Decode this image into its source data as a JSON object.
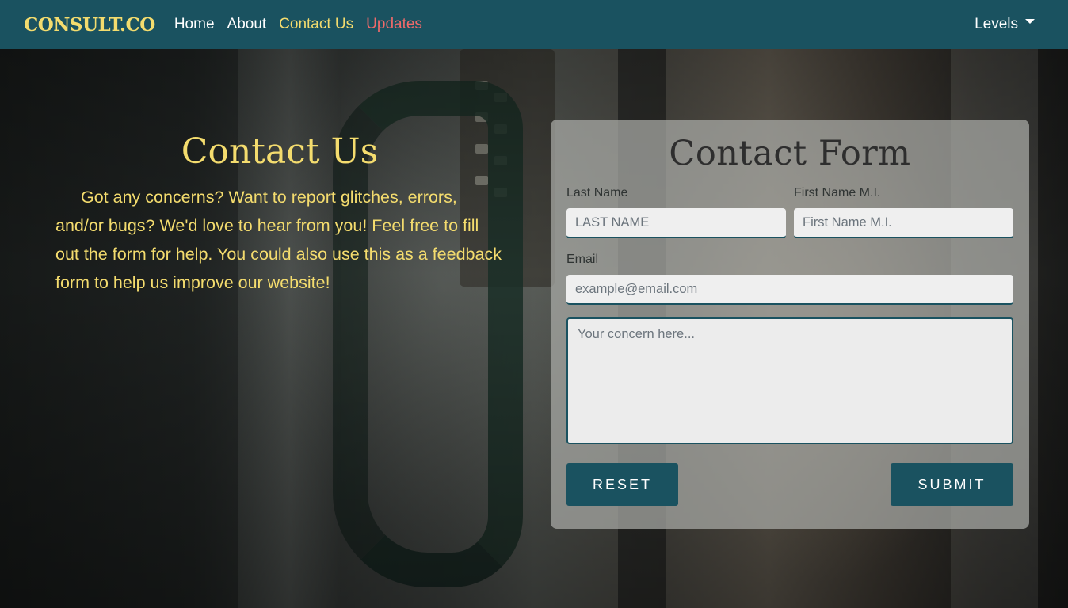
{
  "brand": "CONSULT.CO",
  "nav": {
    "home": "Home",
    "about": "About",
    "contact": "Contact Us",
    "updates": "Updates",
    "levels": "Levels"
  },
  "intro": {
    "title": "Contact Us",
    "text": "Got any concerns? Want to report glitches, errors, and/or bugs? We'd love to hear from you! Feel free to fill out the form for help. You could also use this as a feedback form to help us improve our website!"
  },
  "form": {
    "title": "Contact Form",
    "last_name_label": "Last Name",
    "last_name_placeholder": "LAST NAME",
    "first_name_label": "First Name M.I.",
    "first_name_placeholder": "First Name M.I.",
    "email_label": "Email",
    "email_placeholder": "example@email.com",
    "concern_placeholder": "Your concern here...",
    "reset_label": "RESET",
    "submit_label": "SUBMIT"
  },
  "colors": {
    "navbar": "#1a5260",
    "accent_yellow": "#f4dc6e",
    "updates_red": "#f06a6a",
    "button": "#1a5260"
  },
  "icons": {
    "levels_dropdown": "caret-down-icon"
  }
}
